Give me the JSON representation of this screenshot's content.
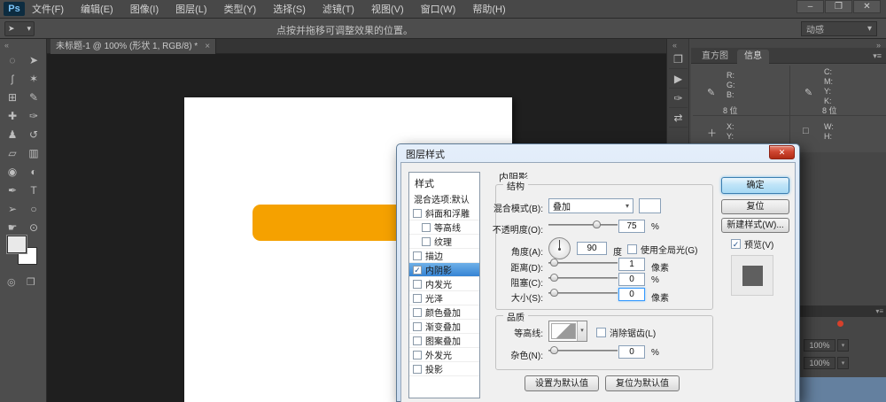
{
  "app": {
    "logo_text": "Ps",
    "menu_items": [
      {
        "id": "file",
        "label": "文件(F)"
      },
      {
        "id": "edit",
        "label": "编辑(E)"
      },
      {
        "id": "image",
        "label": "图像(I)"
      },
      {
        "id": "layer",
        "label": "图层(L)"
      },
      {
        "id": "type",
        "label": "类型(Y)"
      },
      {
        "id": "select",
        "label": "选择(S)"
      },
      {
        "id": "filter",
        "label": "滤镜(T)"
      },
      {
        "id": "view",
        "label": "视图(V)"
      },
      {
        "id": "window",
        "label": "窗口(W)"
      },
      {
        "id": "help",
        "label": "帮助(H)"
      }
    ],
    "window_controls": {
      "minimize": "–",
      "restore": "❐",
      "close": "✕"
    },
    "options_bar": {
      "tool_glyph": "➤",
      "tool_arrow": "▾",
      "hint": "点按并拖移可调整效果的位置。",
      "workspace": "动感",
      "workspace_arrow": "▾"
    }
  },
  "toolbar": {
    "collapse_glyph": "«",
    "tools": [
      {
        "id": "elliptical-marquee-tool",
        "glyph": "◌"
      },
      {
        "id": "move-tool",
        "glyph": "➤"
      },
      {
        "id": "lasso-tool",
        "glyph": "ʃ"
      },
      {
        "id": "magic-wand-tool",
        "glyph": "✶"
      },
      {
        "id": "crop-tool",
        "glyph": "⊞"
      },
      {
        "id": "eyedropper-tool",
        "glyph": "✎"
      },
      {
        "id": "healing-brush-tool",
        "glyph": "✚"
      },
      {
        "id": "brush-tool",
        "glyph": "✑"
      },
      {
        "id": "clone-stamp-tool",
        "glyph": "♟"
      },
      {
        "id": "history-brush-tool",
        "glyph": "↺"
      },
      {
        "id": "eraser-tool",
        "glyph": "▱"
      },
      {
        "id": "gradient-tool",
        "glyph": "▥"
      },
      {
        "id": "blur-tool",
        "glyph": "◉"
      },
      {
        "id": "dodge-tool",
        "glyph": "◐"
      },
      {
        "id": "pen-tool",
        "glyph": "✒"
      },
      {
        "id": "type-tool",
        "glyph": "T"
      },
      {
        "id": "path-selection-tool",
        "glyph": "➢"
      },
      {
        "id": "shape-tool",
        "glyph": "○"
      },
      {
        "id": "hand-tool",
        "glyph": "☛"
      },
      {
        "id": "zoom-tool",
        "glyph": "⊙"
      }
    ],
    "quick_mask_glyph": "◎",
    "screen_mode_glyph": "❒"
  },
  "document": {
    "tab_title": "未标题-1 @ 100% (形状 1, RGB/8) *",
    "tab_close": "×",
    "shape_color": "#F5A100"
  },
  "right_panels": {
    "strip_collapse": "«",
    "panel_collapse": "»",
    "panel_menu": "▾≡",
    "strip_icons": [
      {
        "id": "history-panel",
        "glyph": "❐"
      },
      {
        "id": "actions-panel",
        "glyph": "▶"
      },
      {
        "id": "brush-panel",
        "glyph": "✑"
      },
      {
        "id": "clone-source-panel",
        "glyph": "⇄"
      }
    ],
    "tabs": [
      {
        "id": "histogram",
        "label": "直方图",
        "active": false
      },
      {
        "id": "info",
        "label": "信息",
        "active": true
      }
    ],
    "info": {
      "eyedropper_glyph": "✎",
      "crosshair_glyph": "＋",
      "rect_glyph": "□",
      "rgb_labels": [
        "R:",
        "G:",
        "B:"
      ],
      "rgb_bits": "8 位",
      "cmyk_labels": [
        "C:",
        "M:",
        "Y:",
        "K:"
      ],
      "cmyk_bits": "8 位",
      "xy_labels": [
        "X:",
        "Y:"
      ],
      "wh_labels": [
        "W:",
        "H:"
      ]
    },
    "layers_fragment": {
      "menu_glyph": "▾≡",
      "opacity_value": "100%",
      "fill_value": "100%",
      "dropdown_arrow": "▾"
    }
  },
  "dialog": {
    "title": "图层样式",
    "close_glyph": "✕",
    "styles": {
      "header": "样式",
      "blending_item": "混合选项:默认",
      "items": [
        {
          "id": "bevel-emboss",
          "label": "斜面和浮雕",
          "checked": false,
          "indent": false,
          "selected": false
        },
        {
          "id": "contour",
          "label": "等高线",
          "checked": false,
          "indent": true,
          "selected": false
        },
        {
          "id": "texture",
          "label": "纹理",
          "checked": false,
          "indent": true,
          "selected": false
        },
        {
          "id": "stroke",
          "label": "描边",
          "checked": false,
          "indent": false,
          "selected": false
        },
        {
          "id": "inner-shadow",
          "label": "内阴影",
          "checked": true,
          "indent": false,
          "selected": true
        },
        {
          "id": "inner-glow",
          "label": "内发光",
          "checked": false,
          "indent": false,
          "selected": false
        },
        {
          "id": "satin",
          "label": "光泽",
          "checked": false,
          "indent": false,
          "selected": false
        },
        {
          "id": "color-overlay",
          "label": "颜色叠加",
          "checked": false,
          "indent": false,
          "selected": false
        },
        {
          "id": "gradient-overlay",
          "label": "渐变叠加",
          "checked": false,
          "indent": false,
          "selected": false
        },
        {
          "id": "pattern-overlay",
          "label": "图案叠加",
          "checked": false,
          "indent": false,
          "selected": false
        },
        {
          "id": "outer-glow",
          "label": "外发光",
          "checked": false,
          "indent": false,
          "selected": false
        },
        {
          "id": "drop-shadow",
          "label": "投影",
          "checked": false,
          "indent": false,
          "selected": false
        }
      ]
    },
    "section_title": "内阴影",
    "structure": {
      "group_label": "结构",
      "blend_mode": {
        "label": "混合模式(B):",
        "value": "叠加",
        "arrow": "▾"
      },
      "opacity": {
        "label": "不透明度(O):",
        "value": "75",
        "unit": "%",
        "pos": 0.72
      },
      "angle": {
        "label": "角度(A):",
        "value": "90",
        "unit": "度",
        "global_light_label": "使用全局光(G)",
        "global_light_checked": false
      },
      "distance": {
        "label": "距离(D):",
        "value": "1",
        "unit": "像素",
        "pos": 0.03
      },
      "choke": {
        "label": "阻塞(C):",
        "value": "0",
        "unit": "%",
        "pos": 0.03
      },
      "size": {
        "label": "大小(S):",
        "value": "0",
        "unit": "像素",
        "pos": 0.03
      }
    },
    "quality": {
      "group_label": "品质",
      "contour_label": "等高线:",
      "contour_arrow": "▾",
      "anti_alias_label": "消除锯齿(L)",
      "anti_alias_checked": false,
      "noise": {
        "label": "杂色(N):",
        "value": "0",
        "unit": "%",
        "pos": 0.03
      }
    },
    "buttons": {
      "ok": "确定",
      "reset": "复位",
      "new_style": "新建样式(W)...",
      "preview": "预览(V)",
      "preview_checked": true,
      "make_default": "设置为默认值",
      "reset_default": "复位为默认值"
    }
  }
}
